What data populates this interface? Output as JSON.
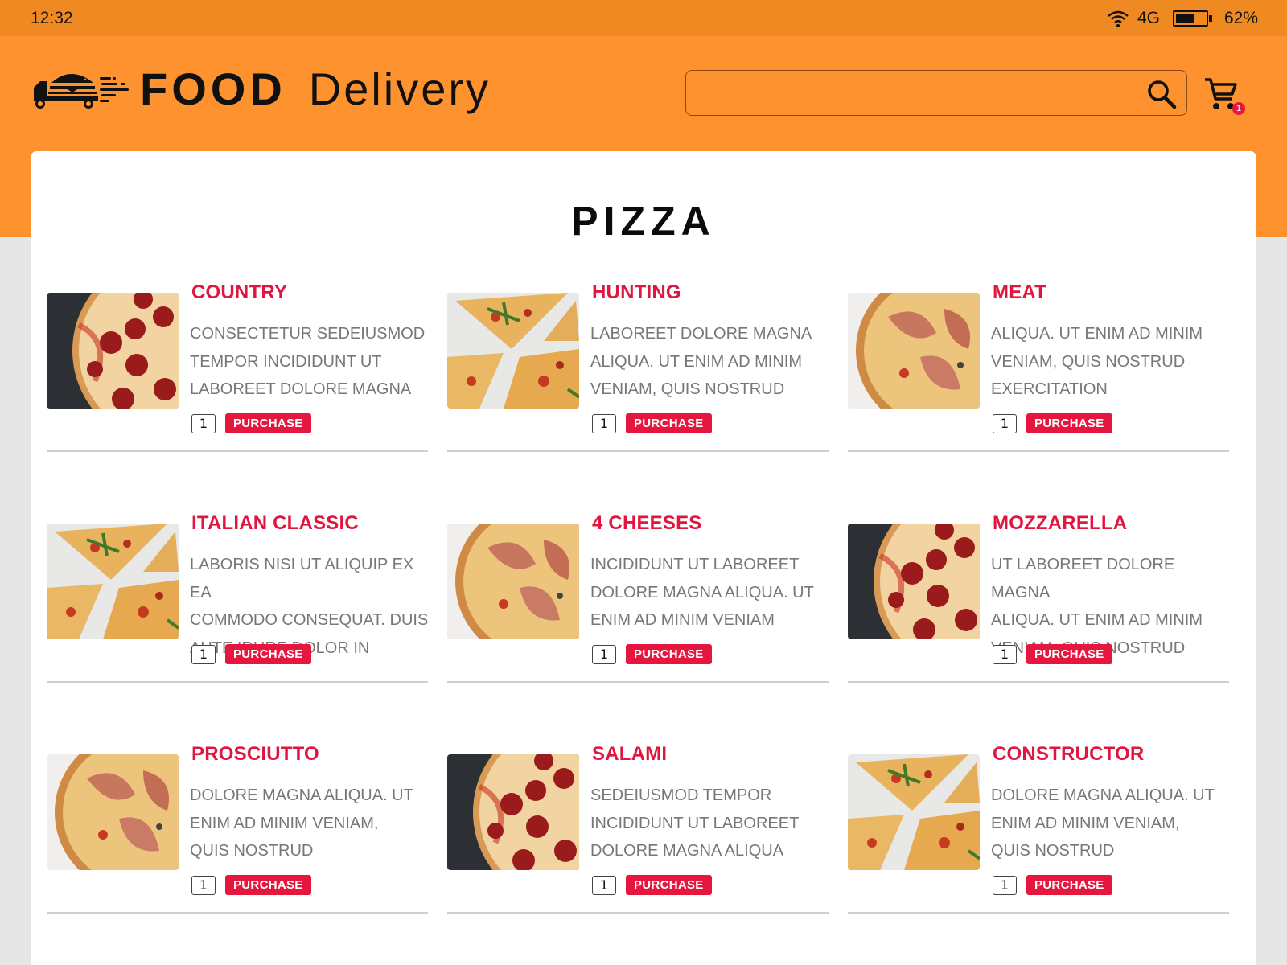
{
  "status_bar": {
    "time": "12:32",
    "network": "4G",
    "battery_percent_label": "62%",
    "battery_level": 0.62,
    "icons": [
      "wifi-icon",
      "battery-icon"
    ]
  },
  "header": {
    "brand_bold": "FOOD",
    "brand_light": "Delivery",
    "logo_icon": "delivery-truck-burger-icon",
    "search": {
      "value": "",
      "placeholder": "",
      "icon": "search-icon"
    },
    "cart": {
      "icon": "cart-icon",
      "badge_count": "1"
    }
  },
  "colors": {
    "status_bar": "#ef8a23",
    "header": "#fd922e",
    "accent_red": "#e5173f",
    "title_red": "#e0163f",
    "desc_gray": "#777777",
    "page_bg": "#e6e6e6"
  },
  "page_title": "PIZZA",
  "products": [
    {
      "name": "COUNTRY",
      "desc": "CONSECTETUR SEDEIUSMOD\nTEMPOR INCIDIDUNT UT\nLABOREET DOLORE MAGNA",
      "qty": "1",
      "button": "PURCHASE",
      "image": "pepperoni-pizza-dark"
    },
    {
      "name": "HUNTING",
      "desc": "LABOREET DOLORE MAGNA\nALIQUA. UT ENIM AD MINIM\nVENIAM, QUIS NOSTRUD",
      "qty": "1",
      "button": "PURCHASE",
      "image": "pizza-slices-arugula"
    },
    {
      "name": "MEAT",
      "desc": " ALIQUA. UT ENIM AD MINIM\nVENIAM, QUIS NOSTRUD\nEXERCITATION",
      "qty": "1",
      "button": "PURCHASE",
      "image": "prosciutto-pizza"
    },
    {
      "name": "ITALIAN CLASSIC",
      "desc": "LABORIS NISI UT ALIQUIP EX EA\nCOMMODO CONSEQUAT. DUIS\nAUTE IRURE DOLOR IN",
      "qty": "1",
      "button": "PURCHASE",
      "image": "pizza-slices-arugula"
    },
    {
      "name": "4 CHEESES",
      "desc": "INCIDIDUNT UT LABOREET\nDOLORE MAGNA ALIQUA. UT\nENIM AD MINIM VENIAM",
      "qty": "1",
      "button": "PURCHASE",
      "image": "prosciutto-pizza"
    },
    {
      "name": "MOZZARELLA",
      "desc": "UT LABOREET DOLORE MAGNA\nALIQUA. UT ENIM AD MINIM\nVENIAM, QUIS NOSTRUD",
      "qty": "1",
      "button": "PURCHASE",
      "image": "pepperoni-pizza-dark"
    },
    {
      "name": "PROSCIUTTO",
      "desc": "DOLORE MAGNA ALIQUA. UT\nENIM AD MINIM VENIAM,\nQUIS NOSTRUD",
      "qty": "1",
      "button": "PURCHASE",
      "image": "prosciutto-pizza"
    },
    {
      "name": "SALAMI",
      "desc": "SEDEIUSMOD TEMPOR\nINCIDIDUNT UT LABOREET\nDOLORE MAGNA ALIQUA",
      "qty": "1",
      "button": "PURCHASE",
      "image": "pepperoni-pizza-dark"
    },
    {
      "name": "CONSTRUCTOR",
      "desc": "DOLORE MAGNA ALIQUA. UT\nENIM AD MINIM VENIAM,\nQUIS NOSTRUD",
      "qty": "1",
      "button": "PURCHASE",
      "image": "pizza-slices-arugula"
    }
  ]
}
